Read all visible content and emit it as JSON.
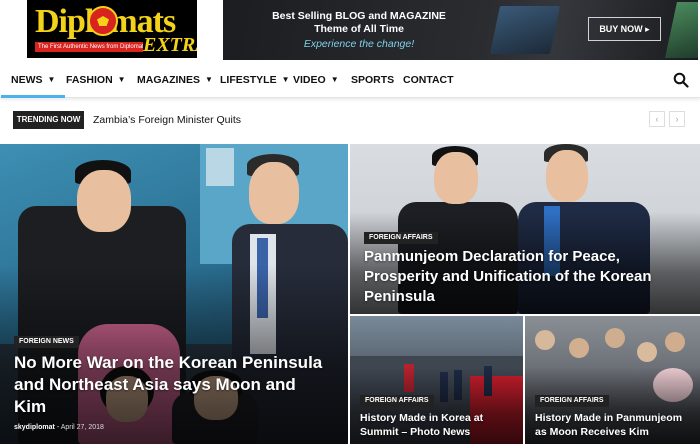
{
  "header": {
    "logo": {
      "main": "Diplomats",
      "suffix": "EXTRA",
      "tagline": "The First Authentic News from Diplomats Circle"
    },
    "banner": {
      "line1": "Best Selling BLOG and MAGAZINE",
      "line2": "Theme of All Time",
      "line3": "Experience the change!",
      "cta": "BUY NOW ▸"
    }
  },
  "nav": {
    "items": [
      {
        "label": "NEWS",
        "has_dropdown": true,
        "active": true
      },
      {
        "label": "FASHION",
        "has_dropdown": true
      },
      {
        "label": "MAGAZINES",
        "has_dropdown": true
      },
      {
        "label": "LIFESTYLE",
        "has_dropdown": true
      },
      {
        "label": "VIDEO",
        "has_dropdown": true
      },
      {
        "label": "SPORTS",
        "has_dropdown": false
      },
      {
        "label": "CONTACT",
        "has_dropdown": false
      }
    ],
    "search_icon": "search-icon",
    "dropdown_icon": "chevron-down-icon"
  },
  "trending": {
    "label": "TRENDING NOW",
    "headline": "Zambia’s Foreign Minister Quits",
    "prev": "‹",
    "next": "›"
  },
  "grid": {
    "main": {
      "category": "FOREIGN NEWS",
      "title": "No More War on the Korean Peninsula and Northeast Asia says Moon and Kim",
      "author": "skydiplomat",
      "date": "April 27, 2018"
    },
    "top_right": {
      "category": "FOREIGN AFFAIRS",
      "title": "Panmunjeom Declaration for Peace, Prosperity and Unification of the Korean Peninsula"
    },
    "bottom_left": {
      "category": "FOREIGN AFFAIRS",
      "title": "History Made in Korea at Summit – Photo News"
    },
    "bottom_right": {
      "category": "FOREIGN AFFAIRS",
      "title": "History Made in Panmunjeom as Moon Receives Kim"
    }
  },
  "colors": {
    "accent": "#4db2ec",
    "logo_gold": "#f3d21a",
    "logo_red": "#d8231f",
    "label_dark": "#222222"
  }
}
